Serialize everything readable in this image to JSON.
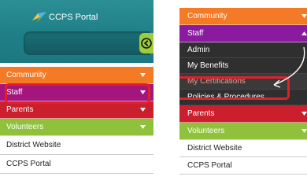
{
  "left": {
    "header": {
      "title": "CCPS Portal",
      "logo_icon": "ccps-bird-logo",
      "collapse_icon": "arrow-left-circle-icon"
    },
    "menu": [
      {
        "label": "Community",
        "color": "#f47a25"
      },
      {
        "label": "Staff",
        "color": "#a4157e",
        "highlighted": true
      },
      {
        "label": "Parents",
        "color": "#cc1f2d"
      },
      {
        "label": "Volunteers",
        "color": "#8fc23a"
      }
    ],
    "links": [
      "District Website",
      "CCPS Portal"
    ]
  },
  "right": {
    "menu_top": [
      {
        "label": "Community",
        "color": "#f47a25"
      },
      {
        "label": "Staff",
        "color": "#8a1aa0",
        "expanded": true
      }
    ],
    "staff_submenu": [
      {
        "label": "Admin"
      },
      {
        "label": "My Benefits"
      },
      {
        "label": "My Certifications",
        "highlighted": true
      },
      {
        "label": "Policies & Procedures"
      }
    ],
    "menu_bottom": [
      {
        "label": "Parents",
        "color": "#cc1f2d"
      },
      {
        "label": "Volunteers",
        "color": "#8fc23a"
      }
    ],
    "links": [
      "District Website",
      "CCPS Portal"
    ]
  },
  "colors": {
    "highlight": "#e0202a",
    "header_teal": "#1f7f87",
    "submenu_bg": "#2f2f2f"
  }
}
